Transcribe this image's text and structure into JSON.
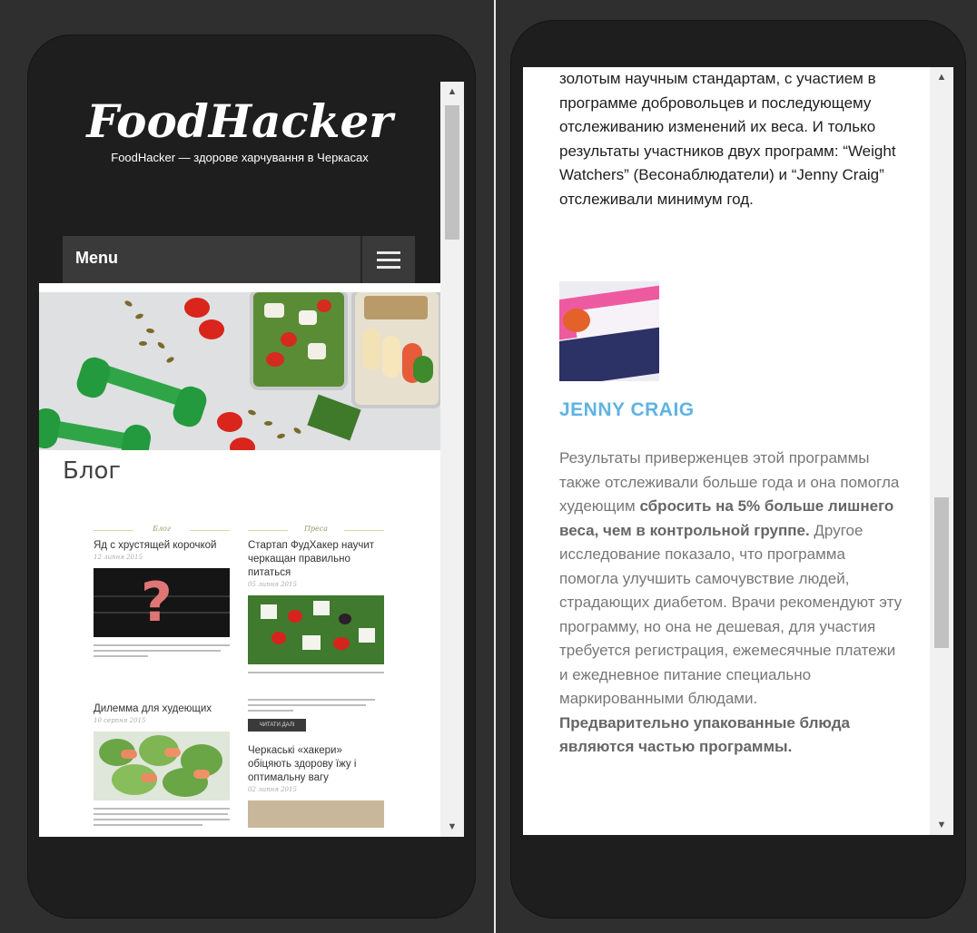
{
  "left_screen": {
    "site": {
      "logo": "FoodHacker",
      "tagline": "FoodHacker — здорове харчування в Черкасах"
    },
    "menu": {
      "label": "Menu"
    },
    "page_title": "Блог",
    "posts": [
      {
        "category": "Блог",
        "title": "Яд с хрустящей корочкой",
        "date": "12 липня 2015"
      },
      {
        "category": "Преса",
        "title": "Стартап ФудХакер научит черкащан правильно питаться",
        "date": "05 липня 2015"
      },
      {
        "title": "Дилемма для худеющих",
        "date": "10 серпня 2015"
      },
      {
        "title": "Черкаські «хакери» обіцяють здорову їжу і оптимальну вагу",
        "date": "02 липня 2015"
      }
    ],
    "read_more_label": "ЧИТАТИ ДАЛІ"
  },
  "right_screen": {
    "article_top": "золотым научным стандартам, с участием в программе добровольцев и последующему отслеживанию изменений их веса. И только результаты участников двух программ:  “Weight Watchers” (Весонаблюдатели) и “Jenny Craig” отслеживали минимум год.",
    "section_heading": "JENNY CRAIG",
    "article_bottom": {
      "p1": "Результаты приверженцев этой программы также отслеживали больше года и она помогла худеющим ",
      "p1_bold": "сбросить на 5% больше лишнего веса, чем в контрольной группе.",
      "p2": " Другое исследование показало, что программа помогла улучшить самочувствие людей, страдающих диабетом. Врачи рекомендуют эту программу, но она не дешевая, для участия требуется регистрация, ежемесячные платежи и ежедневное питание специально маркированными блюдами.",
      "p3_bold": "Предварительно упакованные блюда являются частью программы."
    }
  },
  "icons": {
    "scroll_up": "▲",
    "scroll_down": "▼"
  },
  "colors": {
    "header_bg": "#1e1e1e",
    "menu_bg": "#3a3a3a",
    "heading_blue": "#5fb3e2"
  }
}
